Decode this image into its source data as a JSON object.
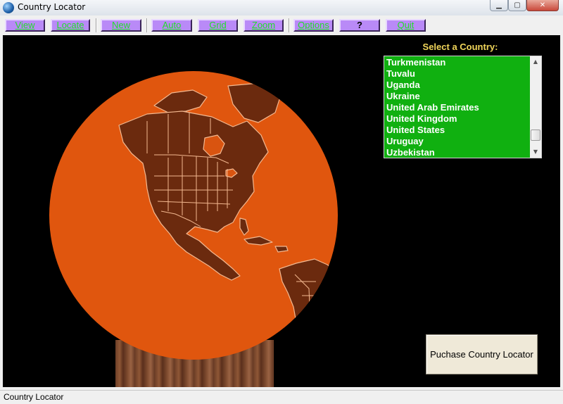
{
  "window": {
    "title": "Country Locator",
    "minimize_glyph": "▁",
    "maximize_glyph": "▢",
    "close_glyph": "✕"
  },
  "toolbar": {
    "buttons": [
      {
        "label": "View"
      },
      {
        "label": "Locate"
      },
      {
        "label": "New"
      },
      {
        "label": "Auto"
      },
      {
        "label": "Grid"
      },
      {
        "label": "Zoom"
      },
      {
        "label": "Options"
      },
      {
        "label": "?"
      },
      {
        "label": "Quit"
      }
    ],
    "button_color": "#b98af7",
    "text_color": "#22e02a"
  },
  "globe": {
    "ocean_color": "#e0560e",
    "land_color": "#6b2a0e",
    "border_color": "#f3b890"
  },
  "country_list": {
    "label": "Select a Country:",
    "items": [
      "Turkmenistan",
      "Tuvalu",
      "Uganda",
      "Ukraine",
      "United Arab Emirates",
      "United Kingdom",
      "United States",
      "Uruguay",
      "Uzbekistan"
    ],
    "background_color": "#10b010",
    "scroll_up_glyph": "▲",
    "scroll_down_glyph": "▼"
  },
  "purchase_button": {
    "label": "Puchase Country Locator"
  },
  "status_bar": {
    "text": "Country Locator"
  }
}
